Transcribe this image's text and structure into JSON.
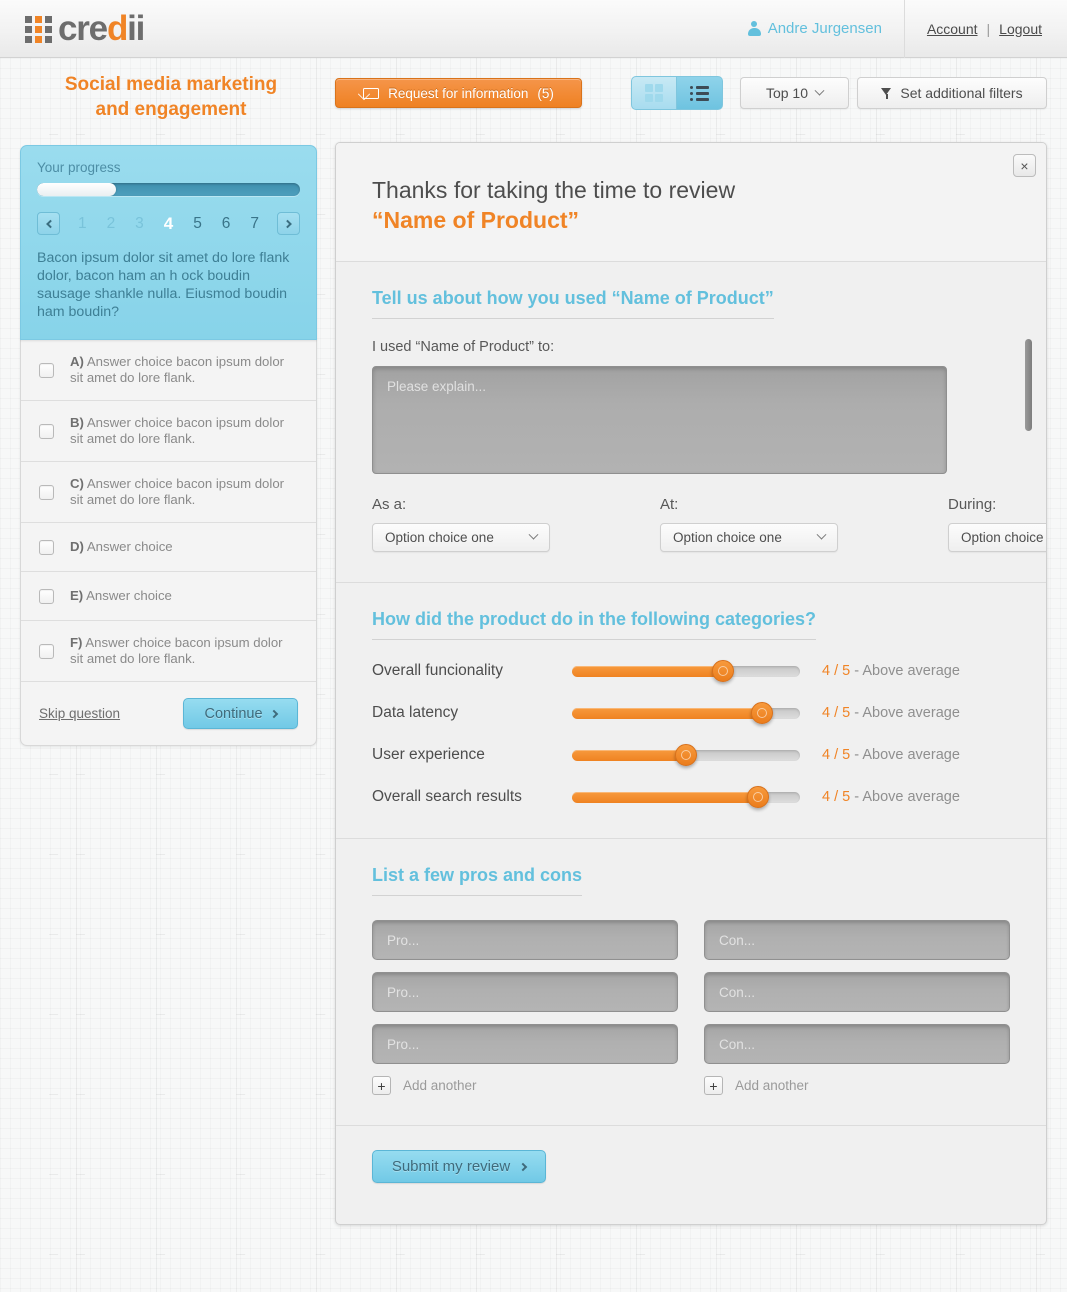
{
  "header": {
    "logo_text_part1": "cre",
    "logo_text_accent": "d",
    "logo_text_part2": "ii",
    "user_name": "Andre Jurgensen",
    "account_label": "Account",
    "separator": "|",
    "logout_label": "Logout",
    "user_icon": "person-icon"
  },
  "toolbar": {
    "page_title": "Social media marketing and engagement",
    "request_button_label": "Request for information",
    "request_button_count": "(5)",
    "request_icon": "mail-icon",
    "view_grid_icon": "grid-view-icon",
    "view_list_icon": "list-view-icon",
    "sort_dropdown_value": "Top 10",
    "filters_button_label": "Set additional filters",
    "filters_icon": "funnel-icon"
  },
  "sidebar": {
    "progress_label": "Your progress",
    "progress_percent": 30,
    "prev_icon": "chevron-left-icon",
    "next_icon": "chevron-right-icon",
    "pages": [
      {
        "label": "1",
        "state": "faded"
      },
      {
        "label": "2",
        "state": "faded"
      },
      {
        "label": "3",
        "state": "faded"
      },
      {
        "label": "4",
        "state": "active"
      },
      {
        "label": "5",
        "state": "normal"
      },
      {
        "label": "6",
        "state": "normal"
      },
      {
        "label": "7",
        "state": "normal"
      }
    ],
    "question": "Bacon ipsum dolor sit amet do lore flank dolor, bacon ham an h ock boudin sausage shankle nulla. Eiusmod boudin ham boudin?",
    "answers": [
      {
        "letter": "A)",
        "text": "Answer choice bacon ipsum dolor sit amet do lore flank."
      },
      {
        "letter": "B)",
        "text": "Answer choice bacon ipsum dolor sit amet do lore flank."
      },
      {
        "letter": "C)",
        "text": "Answer choice bacon ipsum dolor sit amet do lore flank."
      },
      {
        "letter": "D)",
        "text": "Answer choice"
      },
      {
        "letter": "E)",
        "text": "Answer choice"
      },
      {
        "letter": "F)",
        "text": "Answer choice bacon ipsum dolor sit amet do lore flank."
      }
    ],
    "skip_label": "Skip question",
    "continue_label": "Continue"
  },
  "modal": {
    "title_line1": "Thanks for taking the time to review",
    "title_line2": "“Name of Product”",
    "close_icon": "close-icon",
    "close_label": "×",
    "usage": {
      "section_title": "Tell us about how you used “Name of Product”",
      "field_label": "I used “Name of Product” to:",
      "textarea_placeholder": "Please explain...",
      "selects": [
        {
          "label": "As a:",
          "value": "Option choice one"
        },
        {
          "label": "At:",
          "value": "Option choice one"
        },
        {
          "label": "During:",
          "value": "Option choice one"
        }
      ]
    },
    "ratings": {
      "section_title": "How did the product do in the following categories?",
      "items": [
        {
          "label": "Overall funcionality",
          "score": "4",
          "max": "5",
          "descriptor": "Above average",
          "percent": 68
        },
        {
          "label": "Data latency",
          "score": "4",
          "max": "5",
          "descriptor": "Above average",
          "percent": 87
        },
        {
          "label": "User experience",
          "score": "4",
          "max": "5",
          "descriptor": "Above average",
          "percent": 50
        },
        {
          "label": "Overall search results",
          "score": "4",
          "max": "5",
          "descriptor": "Above average",
          "percent": 85
        }
      ]
    },
    "proscons": {
      "section_title": "List a few pros and cons",
      "pro_placeholder": "Pro...",
      "con_placeholder": "Con...",
      "pro_count": 3,
      "con_count": 3,
      "add_another_label": "Add another",
      "plus_icon": "plus-icon"
    },
    "submit_label": "Submit my review"
  },
  "colors": {
    "accent_orange": "#f08426",
    "accent_teal": "#63c0dd",
    "text_dark": "#4d4d4d"
  }
}
